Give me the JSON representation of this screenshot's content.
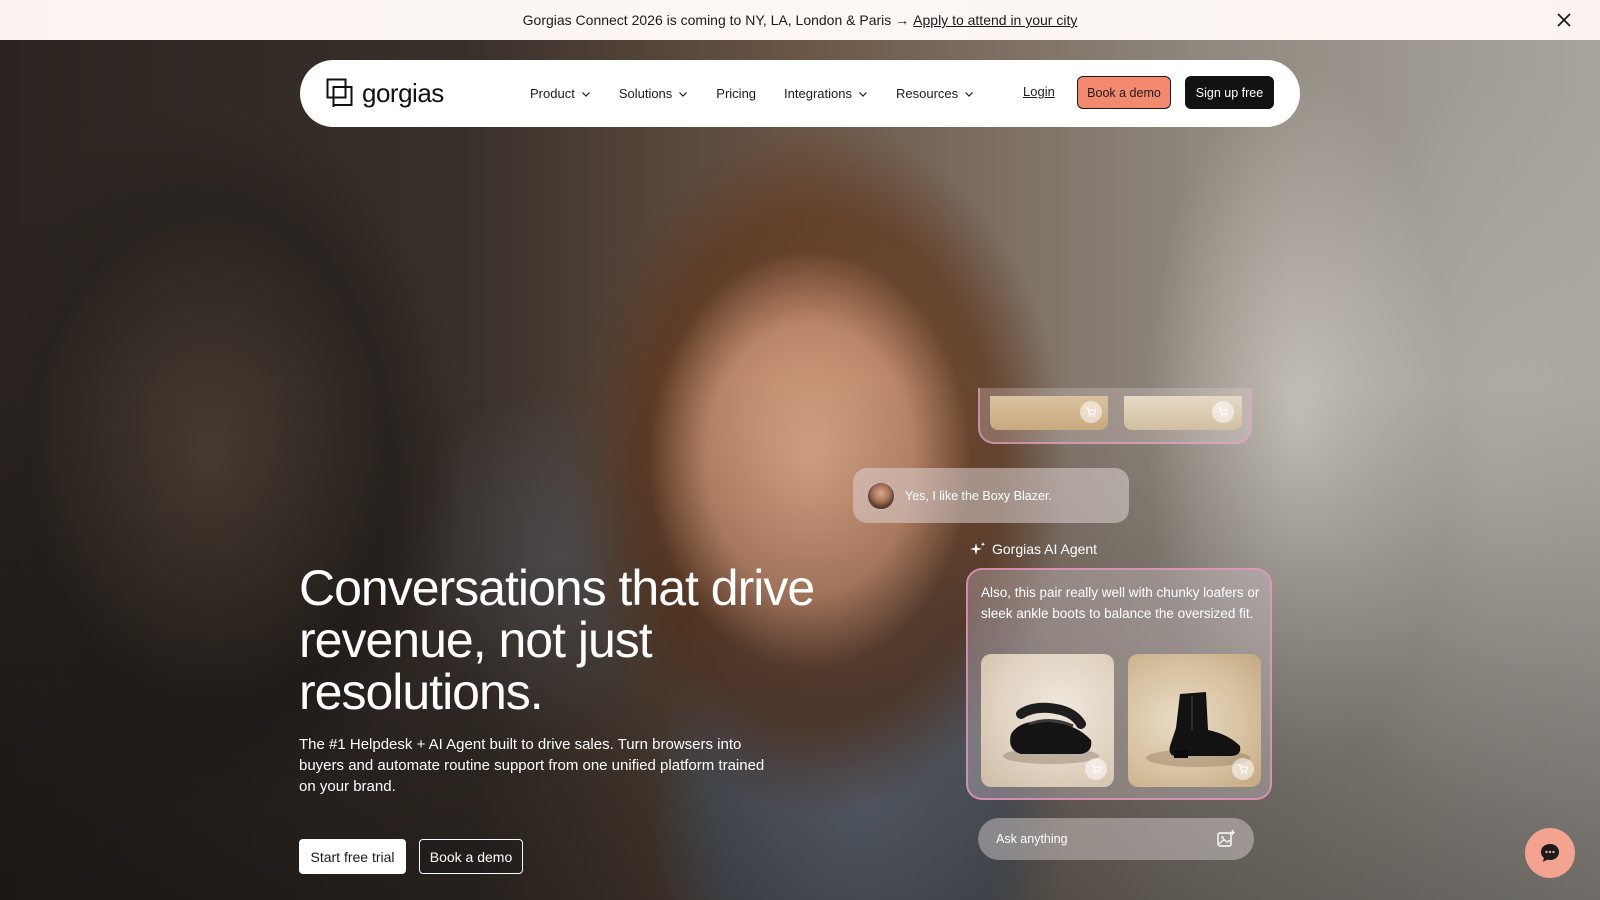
{
  "announcement": {
    "text": "Gorgias Connect 2026 is coming to NY, LA, London & Paris →",
    "link": "Apply to attend in your city"
  },
  "nav": {
    "logo": "gorgias",
    "items": [
      {
        "label": "Product",
        "dropdown": true
      },
      {
        "label": "Solutions",
        "dropdown": true
      },
      {
        "label": "Pricing",
        "dropdown": false
      },
      {
        "label": "Integrations",
        "dropdown": true
      },
      {
        "label": "Resources",
        "dropdown": true
      }
    ],
    "login": "Login",
    "book_demo": "Book a demo",
    "sign_up": "Sign up free"
  },
  "hero": {
    "headline": "Conversations that drive revenue, not just resolutions.",
    "subtext": "The #1 Helpdesk + AI Agent built to drive sales. Turn browsers into buyers and automate routine support from one unified platform trained on your brand.",
    "cta_primary": "Start free trial",
    "cta_secondary": "Book a demo"
  },
  "chat": {
    "user_message": "Yes, I like the Boxy Blazer.",
    "agent_name": "Gorgias AI Agent",
    "agent_message": "Also, this pair really well with chunky loafers or sleek ankle boots to balance the oversized fit.",
    "input_placeholder": "Ask anything"
  },
  "colors": {
    "accent": "#f38a70",
    "dark": "#121212",
    "agent_border": "#ec96c3"
  }
}
